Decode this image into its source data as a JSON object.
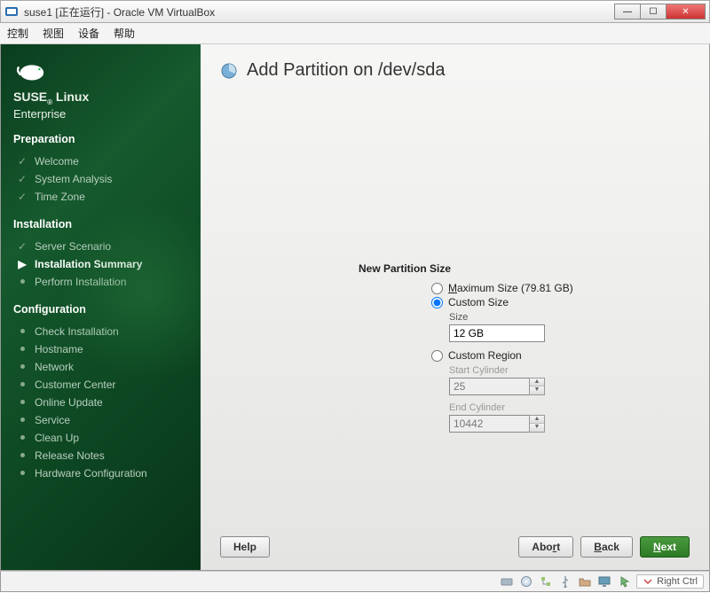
{
  "window": {
    "title": "suse1 [正在运行] - Oracle VM VirtualBox",
    "menus": {
      "control": "控制",
      "view": "视图",
      "devices": "设备",
      "help": "帮助"
    },
    "buttons": {
      "min": "—",
      "max": "☐",
      "close": "✕"
    },
    "hostkey": "Right Ctrl"
  },
  "brand": {
    "line1": "SUSE",
    "line1b": "Linux",
    "line2": "Enterprise"
  },
  "stages": {
    "preparation": "Preparation",
    "installation": "Installation",
    "configuration": "Configuration"
  },
  "steps": {
    "welcome": "Welcome",
    "system_analysis": "System Analysis",
    "time_zone": "Time Zone",
    "server_scenario": "Server Scenario",
    "installation_summary": "Installation Summary",
    "perform_installation": "Perform Installation",
    "check_installation": "Check Installation",
    "hostname": "Hostname",
    "network": "Network",
    "customer_center": "Customer Center",
    "online_update": "Online Update",
    "service": "Service",
    "clean_up": "Clean Up",
    "release_notes": "Release Notes",
    "hardware_config": "Hardware Configuration"
  },
  "page": {
    "title": "Add Partition on /dev/sda",
    "group": "New Partition Size",
    "max_label_pre": "M",
    "max_label": "aximum Size (79.81 GB)",
    "custom_size_label": "Custom Size",
    "size_field": "Size",
    "size_value": "12 GB",
    "custom_region_label": "Custom Region",
    "start_cyl": "Start Cylinder",
    "start_val": "25",
    "end_cyl": "End Cylinder",
    "end_val": "10442",
    "help": "Help",
    "abort_pre": "Abo",
    "abort_u": "r",
    "abort_post": "t",
    "back_u": "B",
    "back_post": "ack",
    "next_u": "N",
    "next_post": "ext"
  }
}
